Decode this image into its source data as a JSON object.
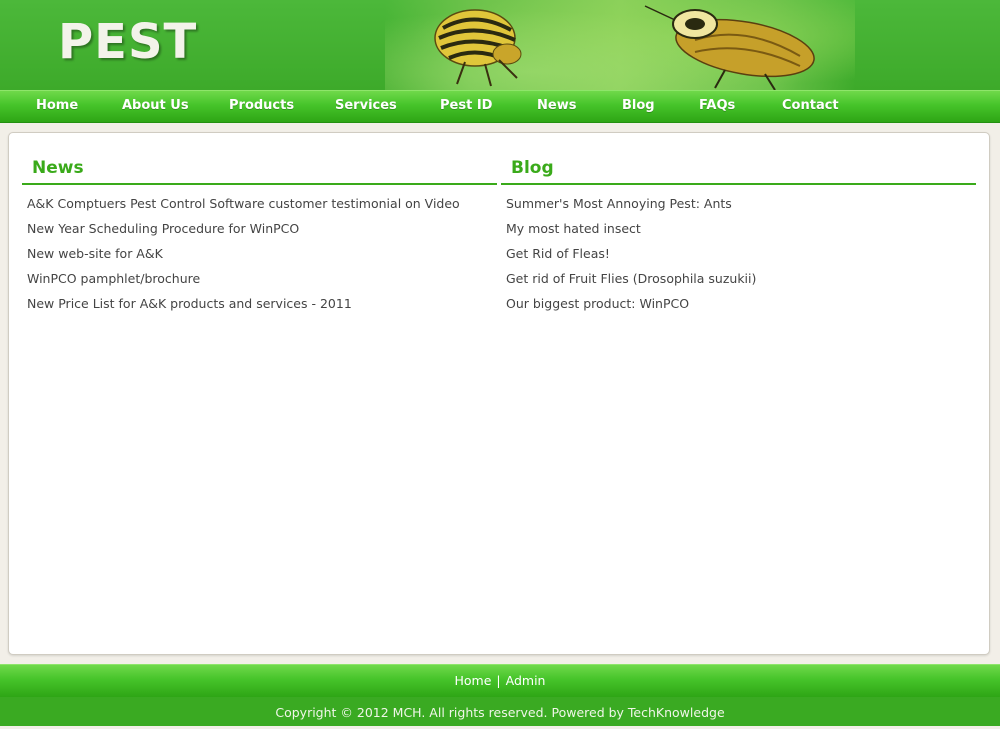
{
  "header": {
    "logo": "PEST"
  },
  "nav": {
    "items": [
      {
        "label": "Home"
      },
      {
        "label": "About Us"
      },
      {
        "label": "Products"
      },
      {
        "label": "Services"
      },
      {
        "label": "Pest ID"
      },
      {
        "label": "News"
      },
      {
        "label": "Blog"
      },
      {
        "label": "FAQs"
      },
      {
        "label": "Contact"
      }
    ]
  },
  "news": {
    "title": "News",
    "items": [
      "A&K Comptuers Pest Control Software customer testimonial on Video",
      "New Year Scheduling Procedure for WinPCO",
      "New web-site for A&K",
      "WinPCO pamphlet/brochure",
      "New Price List for A&K products and services - 2011"
    ]
  },
  "blog": {
    "title": "Blog",
    "items": [
      "Summer's Most Annoying Pest: Ants",
      "My most hated insect",
      "Get Rid of Fleas!",
      "Get rid of Fruit Flies (Drosophila suzukii)",
      "Our biggest product: WinPCO"
    ]
  },
  "footer": {
    "links": [
      {
        "label": "Home"
      },
      {
        "label": "Admin"
      }
    ],
    "separator": "|",
    "copyright": "Copyright © 2012 MCH. All rights reserved. Powered by TechKnowledge"
  },
  "colors": {
    "brand_green": "#3aaa1a",
    "nav_green": "#46c42a"
  },
  "icons": [
    "colorado-beetle-image",
    "cockroach-image"
  ]
}
